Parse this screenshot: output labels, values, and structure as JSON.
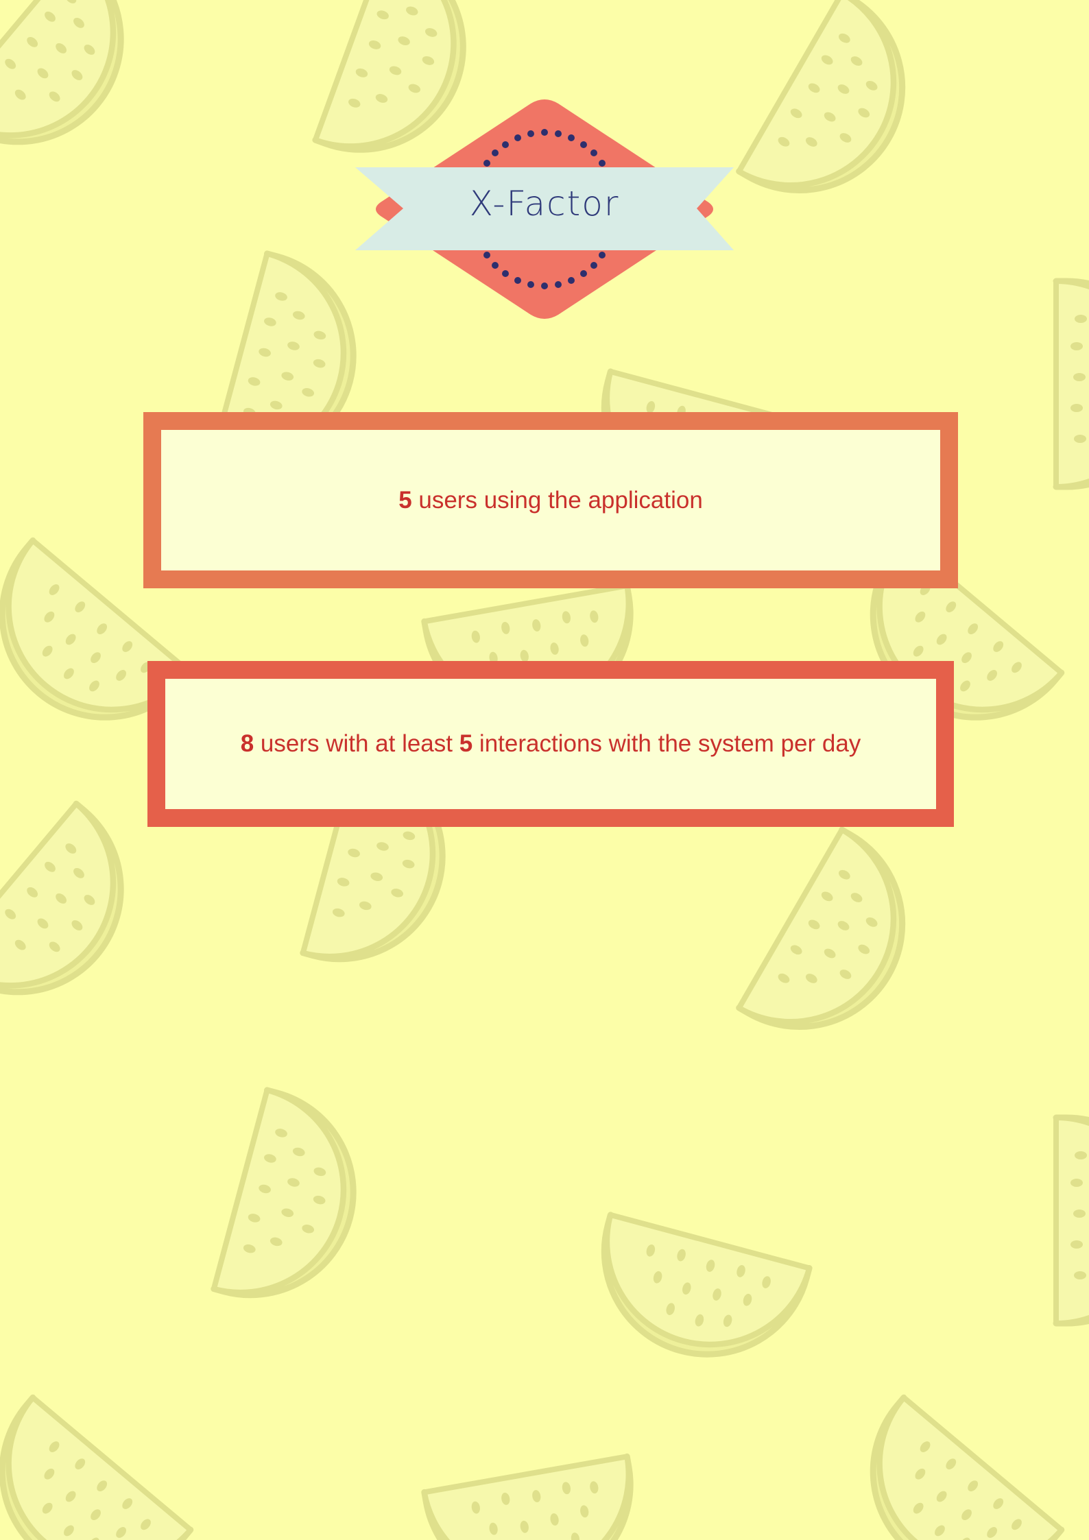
{
  "title": "X-Factor",
  "colors": {
    "background": "#fcfea8",
    "badge_diamond": "#f07565",
    "badge_ribbon": "#d8ece6",
    "badge_dots": "#2d2f6e",
    "box1_border": "#e67a52",
    "box2_border": "#e5604a",
    "box_fill": "#fcffd3",
    "text": "#c9302c"
  },
  "decoration": "watermelon-slice-pattern",
  "stats": [
    {
      "number": "5",
      "text": " users using the application"
    },
    {
      "number": "8",
      "text_a": " users with at least ",
      "number_b": "5",
      "text_b": " interactions with the system per day"
    }
  ]
}
